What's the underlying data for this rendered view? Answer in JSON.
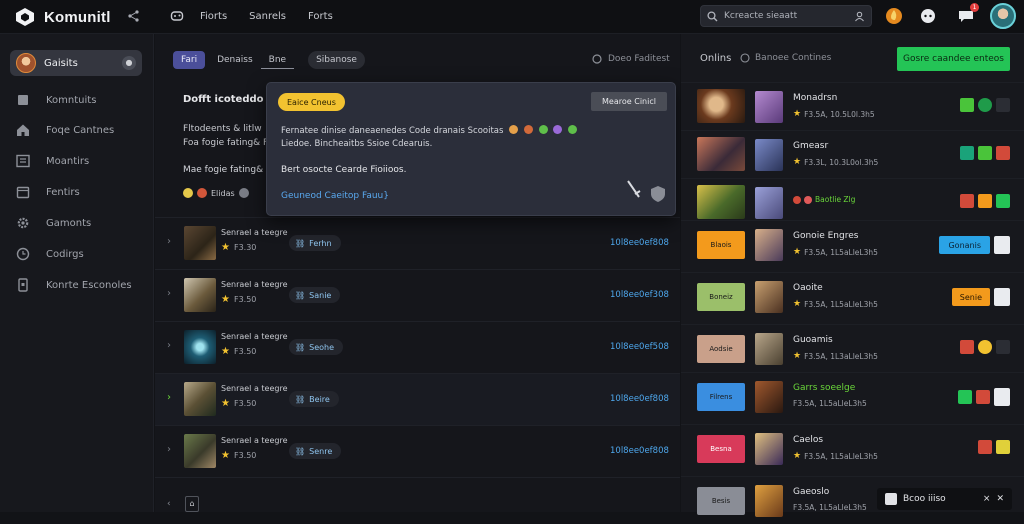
{
  "app": {
    "name": "Komunitl",
    "brand_color": "#f2f3f5"
  },
  "topnav": {
    "links": [
      "Fiorts",
      "Sanrels",
      "Forts"
    ]
  },
  "search": {
    "placeholder": "Kcreacte sieaatt"
  },
  "top_icons": [
    "flame-icon",
    "discord-icon",
    "notification-icon"
  ],
  "notification_count": "1",
  "sidebar": {
    "profile_name": "Gaisits",
    "items": [
      {
        "label": "Komntuits",
        "icon": "community-icon"
      },
      {
        "label": "Foqe Cantnes",
        "icon": "home-icon"
      },
      {
        "label": "Moantirs",
        "icon": "monitor-icon"
      },
      {
        "label": "Fentirs",
        "icon": "calendar-icon"
      },
      {
        "label": "Gamonts",
        "icon": "settings-icon"
      },
      {
        "label": "Codirgs",
        "icon": "clock-icon"
      },
      {
        "label": "Konrte Esconoles",
        "icon": "phone-icon"
      }
    ]
  },
  "tabs": [
    {
      "label": "Fari",
      "active": true
    },
    {
      "label": "Denaiss"
    },
    {
      "label": "Bne"
    },
    {
      "label": "Sibanose"
    }
  ],
  "main_filter": "Doeo Faditest",
  "list": {
    "header": "Dofft icoteddo",
    "desc1": "Fltodeents & litlw",
    "desc2": "Foa fogie fating& Fuiess",
    "desc3": "Mae fogie fating& Fuiess",
    "row_icons_label": "Elidas"
  },
  "popup": {
    "tag": "Eaice Cneus",
    "button": "Mearoe Cinicl",
    "line1": "Fernatee dinise daneaenedes Code dranais Scooitas",
    "line2": "Liedoe. Bincheaitbs Ssioe Cdearuis.",
    "line3": "Bert osocte Cearde Fioiioos.",
    "link": "Geuneod Caeitop Fauu}"
  },
  "rows": [
    {
      "title": "Senrael a teegre",
      "rating": "F3.30",
      "chip": "Ferhn",
      "number": "10l8ee0ef808",
      "active": false
    },
    {
      "title": "Senrael a teegre",
      "rating": "F3.50",
      "chip": "Sanie",
      "number": "10l8ee0ef308",
      "active": false
    },
    {
      "title": "Senrael a teegre",
      "rating": "F3.50",
      "chip": "Seohe",
      "number": "10l8ee0ef508",
      "active": false
    },
    {
      "title": "Senrael a teegre",
      "rating": "F3.50",
      "chip": "Beire",
      "number": "10l8ee0ef808",
      "active": true
    },
    {
      "title": "Senrael a teegre",
      "rating": "F3.50",
      "chip": "Senre",
      "number": "10l8ee0ef808",
      "active": false
    }
  ],
  "right_panel": {
    "title": "Onlins",
    "subtitle": "Banoee Contines",
    "action_button": "Gosre caandee enteos",
    "rows": [
      {
        "title": "Monadrsn",
        "sub": "F3.5A, 10.5L0l.3h5",
        "tag": "",
        "action": "",
        "action_type": "icons"
      },
      {
        "title": "Gmeasr",
        "sub": "F3.3L, 10.3L0ol.3h5",
        "tag": "",
        "action": "",
        "action_type": "icons"
      },
      {
        "title": "",
        "sub": "Baotlie Zlg",
        "tag": "",
        "action": "",
        "action_type": "icons"
      },
      {
        "title": "Gonoie Engres",
        "sub": "F3.5A, 1L5aLleL3h5",
        "tag": "Blaois",
        "action": "Gonanis",
        "action_type": "blue"
      },
      {
        "title": "Oaoite",
        "sub": "F3.5A, 1L5aLleL3h5",
        "tag": "Boneiz",
        "action": "Senie",
        "action_type": "orange"
      },
      {
        "title": "Guoamis",
        "sub": "F3.5A, 1L3aLleL3h5",
        "tag": "Aodsie",
        "action": "",
        "action_type": "icons"
      },
      {
        "title": "Garrs soeelge",
        "sub": "F3.5A, 1L5aLleL3h5",
        "tag": "Filrens",
        "action": "",
        "action_type": "icons"
      },
      {
        "title": "Caelos",
        "sub": "F3.5A, 1L5aLleL3h5",
        "tag": "Besna",
        "action": "",
        "action_type": "icons"
      },
      {
        "title": "Gaeoslo",
        "sub": "F3.5A, 1L5aLleL3h5",
        "tag": "Besis",
        "action": "",
        "action_type": "icons"
      }
    ]
  },
  "chatbar": {
    "label": "Bcoo iiiso"
  },
  "colors": {
    "accent_green": "#24c456",
    "accent_blue": "#2aa3e6",
    "tag_yellow": "#f2c230",
    "tab_active": "#4b4f9a"
  }
}
